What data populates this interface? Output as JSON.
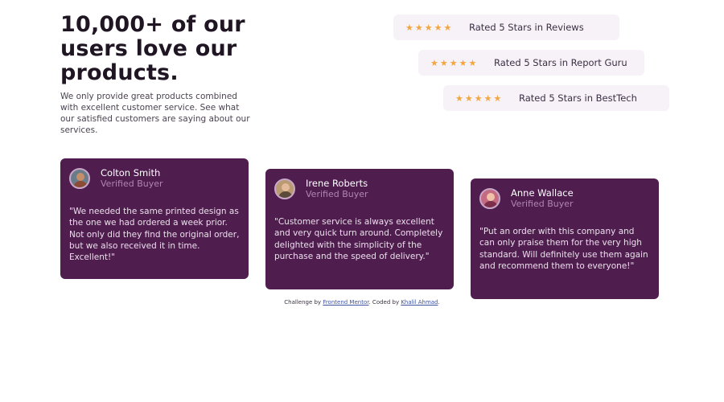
{
  "header": {
    "title": "10,000+ of our users love our products.",
    "description": "We only provide great products combined with excellent customer service. See what our satisfied customers are saying about our services."
  },
  "ratings": [
    {
      "stars": 5,
      "label": "Rated 5 Stars in Reviews"
    },
    {
      "stars": 5,
      "label": "Rated 5 Stars in Report Guru"
    },
    {
      "stars": 5,
      "label": "Rated 5 Stars in BestTech"
    }
  ],
  "testimonials": [
    {
      "name": "Colton Smith",
      "role": "Verified Buyer",
      "quote": "\"We needed the same printed design as the one we had ordered a week prior. Not only did they find the original order, but we also received it in time. Excellent!\""
    },
    {
      "name": "Irene Roberts",
      "role": "Verified Buyer",
      "quote": "\"Customer service is always excellent and very quick turn around. Completely delighted with the simplicity of the purchase and the speed of delivery.\""
    },
    {
      "name": "Anne Wallace",
      "role": "Verified Buyer",
      "quote": "\"Put an order with this company and can only praise them for the very high standard. Will definitely use them again and recommend them to everyone!\""
    }
  ],
  "attribution": {
    "prefix": "Challenge by",
    "link1": "Frontend Mentor",
    "middle": ". Coded by",
    "link2": "Khalil Ahmad",
    "suffix": "."
  },
  "colors": {
    "accent": "#4f1e4f",
    "star": "#f2a63f",
    "rating_bg": "#f7f2f8"
  },
  "icons": {
    "star": "star-icon"
  }
}
